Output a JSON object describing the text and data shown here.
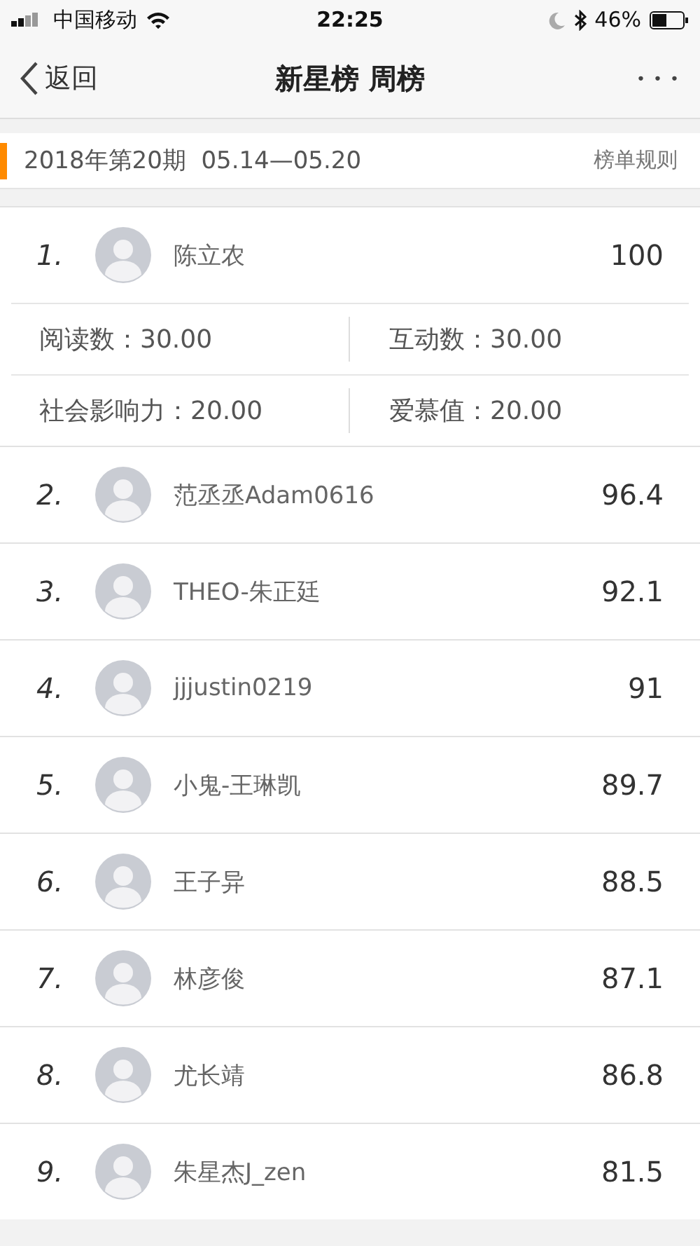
{
  "status_bar": {
    "carrier": "中国移动",
    "time": "22:25",
    "battery": "46%"
  },
  "nav": {
    "back": "返回",
    "title": "新星榜 周榜",
    "more": "• • •"
  },
  "period": {
    "label": "2018年第20期  05.14—05.20",
    "rules": "榜单规则"
  },
  "ranking": [
    {
      "rank": "1.",
      "name": "陈立农",
      "score": "100",
      "stats": [
        {
          "label": "阅读数：",
          "value": "30.00"
        },
        {
          "label": "互动数：",
          "value": "30.00"
        },
        {
          "label": "社会影响力：",
          "value": "20.00"
        },
        {
          "label": "爱慕值：",
          "value": "20.00"
        }
      ]
    },
    {
      "rank": "2.",
      "name": "范丞丞Adam0616",
      "score": "96.4"
    },
    {
      "rank": "3.",
      "name": "THEO-朱正廷",
      "score": "92.1"
    },
    {
      "rank": "4.",
      "name": "jjjustin0219",
      "score": "91"
    },
    {
      "rank": "5.",
      "name": "小鬼-王琳凯",
      "score": "89.7"
    },
    {
      "rank": "6.",
      "name": "王子异",
      "score": "88.5"
    },
    {
      "rank": "7.",
      "name": "林彦俊",
      "score": "87.1"
    },
    {
      "rank": "8.",
      "name": "尤长靖",
      "score": "86.8"
    },
    {
      "rank": "9.",
      "name": "朱星杰J_zen",
      "score": "81.5"
    }
  ]
}
